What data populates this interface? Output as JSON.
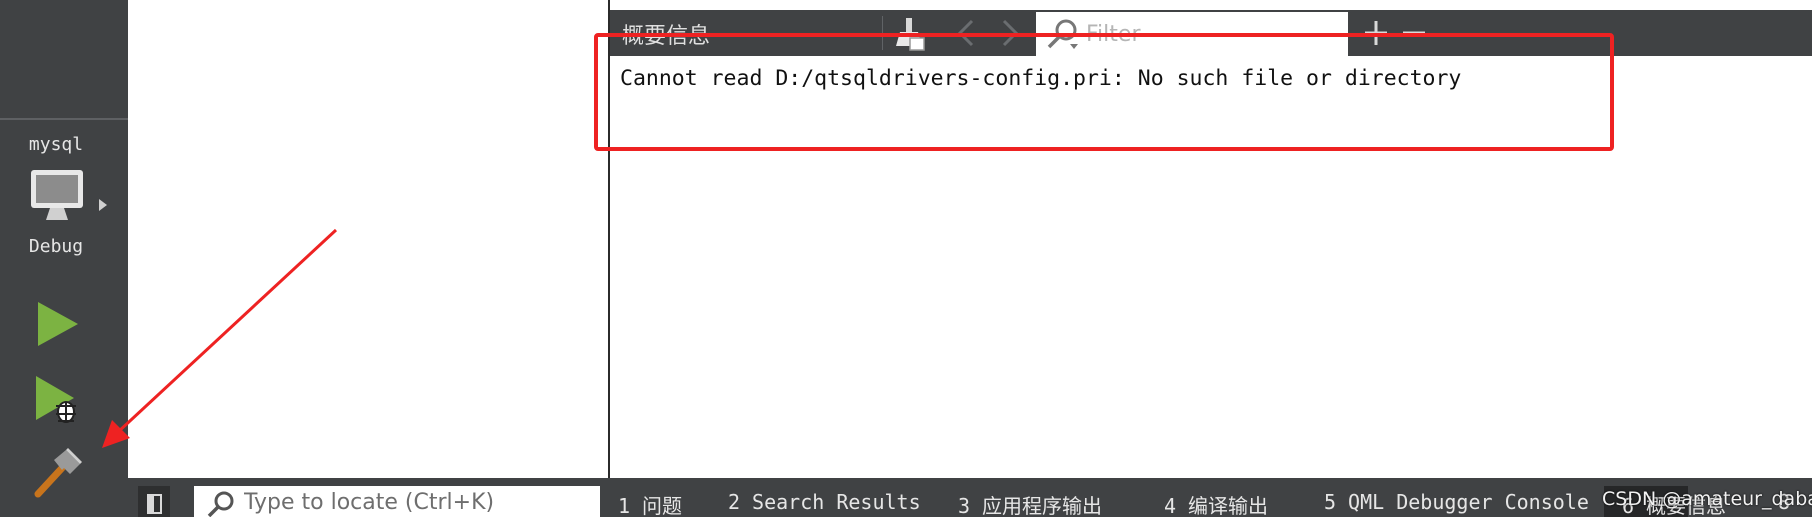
{
  "modebar": {
    "kit_name": "mysql",
    "build_mode": "Debug",
    "icons": [
      "monitor-icon",
      "run-icon",
      "debug-run-icon",
      "build-hammer-icon"
    ]
  },
  "output_pane": {
    "title": "概要信息",
    "filter_placeholder": "Filter",
    "message": "Cannot read D:/qtsqldrivers-config.pri: No such file or directory"
  },
  "statusbar": {
    "locator_placeholder": "Type to locate (Ctrl+K)",
    "tabs": [
      {
        "num": "1",
        "label": "问题"
      },
      {
        "num": "2",
        "label": "Search Results"
      },
      {
        "num": "3",
        "label": "应用程序输出"
      },
      {
        "num": "4",
        "label": "编译输出"
      },
      {
        "num": "5",
        "label": "QML Debugger Console"
      },
      {
        "num": "6",
        "label": "概要信息"
      },
      {
        "num": "8",
        "label": ""
      }
    ],
    "watermark": "CSDN @amateur_dabai"
  },
  "colors": {
    "annotation": "#ee2222",
    "sidebar_bg": "#404244",
    "run_green": "#7cb342"
  }
}
